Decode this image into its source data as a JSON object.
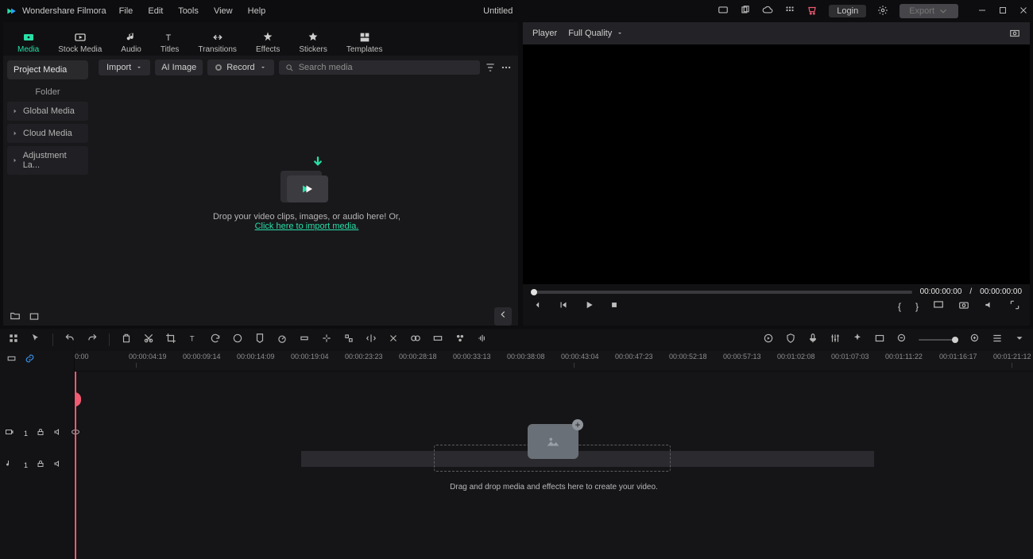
{
  "app": {
    "name": "Wondershare Filmora",
    "title": "Untitled"
  },
  "menu": [
    "File",
    "Edit",
    "Tools",
    "View",
    "Help"
  ],
  "titlebar": {
    "login": "Login",
    "export": "Export"
  },
  "tabs": [
    {
      "id": "media",
      "label": "Media",
      "active": true
    },
    {
      "id": "stock",
      "label": "Stock Media"
    },
    {
      "id": "audio",
      "label": "Audio"
    },
    {
      "id": "titles",
      "label": "Titles"
    },
    {
      "id": "transitions",
      "label": "Transitions"
    },
    {
      "id": "effects",
      "label": "Effects"
    },
    {
      "id": "stickers",
      "label": "Stickers"
    },
    {
      "id": "templates",
      "label": "Templates"
    }
  ],
  "sidebar": {
    "project_media": "Project Media",
    "folder": "Folder",
    "items": [
      "Global Media",
      "Cloud Media",
      "Adjustment La..."
    ]
  },
  "media_tb": {
    "import": "Import",
    "ai_image": "AI Image",
    "record": "Record",
    "search_ph": "Search media"
  },
  "drop": {
    "line": "Drop your video clips, images, or audio here! Or,",
    "link": "Click here to import media."
  },
  "player": {
    "label": "Player",
    "quality": "Full Quality",
    "cur": "00:00:00:00",
    "sep": "/",
    "dur": "00:00:00:00"
  },
  "timeline": {
    "stamps": [
      "0:00",
      "00:00:04:19",
      "00:00:09:14",
      "00:00:14:09",
      "00:00:19:04",
      "00:00:23:23",
      "00:00:28:18",
      "00:00:33:13",
      "00:00:38:08",
      "00:00:43:04",
      "00:00:47:23",
      "00:00:52:18",
      "00:00:57:13",
      "00:01:02:08",
      "00:01:07:03",
      "00:01:11:22",
      "00:01:16:17",
      "00:01:21:12"
    ],
    "hint": "Drag and drop media and effects here to create your video."
  },
  "glyphs": {
    "brace_l": "{",
    "brace_r": "}",
    "one": "1"
  }
}
